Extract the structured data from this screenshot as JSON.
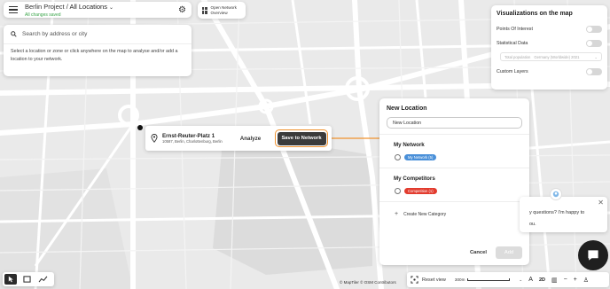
{
  "header": {
    "project_name": "Berlin Project",
    "separator": " / ",
    "view_name": "All Locations",
    "save_status": "All changes saved"
  },
  "search": {
    "placeholder": "Search by address or city",
    "help_text": "Select a location or zone or click anywhere on the map to analyse and/or add a location to your network."
  },
  "overview": {
    "label": "Open Network Overview"
  },
  "visualizations": {
    "title": "Visualizations on the map",
    "items": [
      {
        "label": "Points Of Interest"
      },
      {
        "label": "Statistical Data"
      },
      {
        "label": "Custom Layers"
      }
    ],
    "select_label": "Total population",
    "select_sub": "Germany (Worldwide) 2021"
  },
  "location": {
    "name": "Ernst-Reuter-Platz 1",
    "address": "10587, Berlin, Charlottenburg, Berlin",
    "analyze_label": "Analyze",
    "save_label": "Save to Network"
  },
  "new_location": {
    "title": "New Location",
    "name_value": "New Location",
    "sections": [
      {
        "title": "My Network",
        "badge": "My Network (5)"
      },
      {
        "title": "My Competitors",
        "badge": "Competition (1)"
      }
    ],
    "create_label": "Create New Category",
    "cancel_label": "Cancel",
    "add_label": "Add"
  },
  "chat": {
    "line1": "y questions? I'm happy to",
    "line2": "ou."
  },
  "footer": {
    "attribution": "© MapTiler  © OSM Contributors",
    "reset_label": "Reset view",
    "scale_label": "300m",
    "mode_2d": "2D"
  },
  "colors": {
    "accent_orange": "#f0922e",
    "network_blue": "#4a90d9",
    "competitor_red": "#e23b2e",
    "saved_green": "#3aa54a"
  }
}
